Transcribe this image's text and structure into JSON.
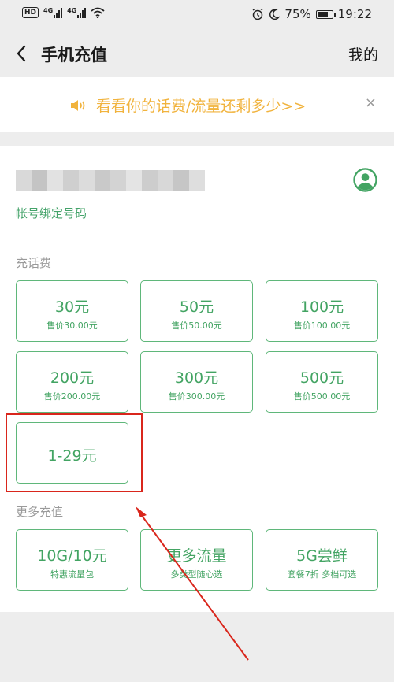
{
  "status_bar": {
    "hd_label": "HD",
    "net1_label": "4G",
    "net2_label": "4G",
    "battery": "75%",
    "time": "19:22",
    "battery_level": 0.75
  },
  "nav": {
    "title": "手机充值",
    "right_label": "我的"
  },
  "banner": {
    "text": "看看你的话费/流量还剩多少>>",
    "close": "×",
    "accent_color": "#f1b33d"
  },
  "account": {
    "label": "帐号绑定号码"
  },
  "sections": {
    "recharge_label": "充话费",
    "more_label": "更多充值"
  },
  "recharge_tiles": [
    {
      "main": "30元",
      "sub": "售价30.00元"
    },
    {
      "main": "50元",
      "sub": "售价50.00元"
    },
    {
      "main": "100元",
      "sub": "售价100.00元"
    },
    {
      "main": "200元",
      "sub": "售价200.00元"
    },
    {
      "main": "300元",
      "sub": "售价300.00元"
    },
    {
      "main": "500元",
      "sub": "售价500.00元"
    },
    {
      "main": "1-29元",
      "sub": ""
    }
  ],
  "more_tiles": [
    {
      "main": "10G/10元",
      "sub": "特惠流量包"
    },
    {
      "main": "更多流量",
      "sub": "多类型随心选"
    },
    {
      "main": "5G尝鲜",
      "sub": "套餐7折 多档可选"
    }
  ],
  "colors": {
    "brand_green": "#43a463",
    "annotation_red": "#d9261c",
    "background": "#ededed"
  }
}
